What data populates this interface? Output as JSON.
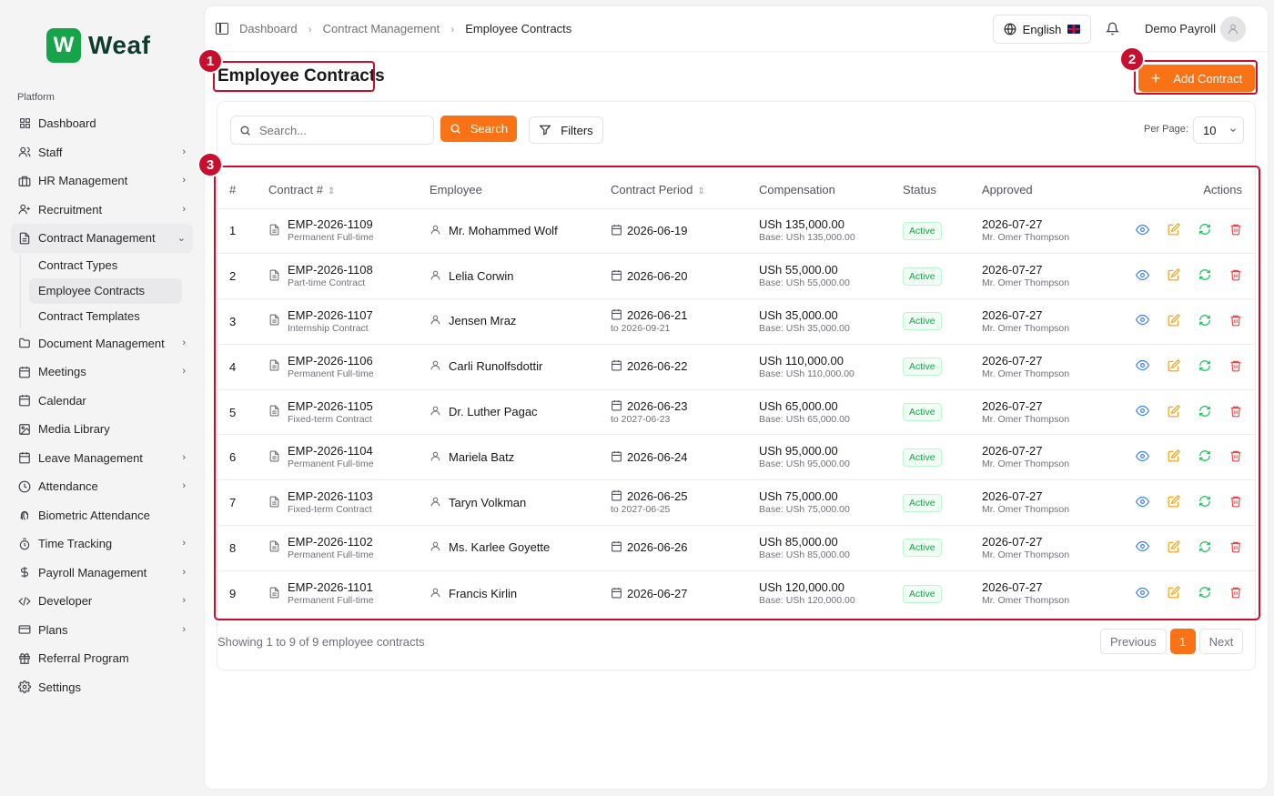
{
  "brand": {
    "mark": "W",
    "name": "Weaf"
  },
  "sidebar": {
    "section": "Platform",
    "items": [
      {
        "label": "Dashboard",
        "icon": "grid-icon",
        "chevron": false
      },
      {
        "label": "Staff",
        "icon": "users-icon",
        "chevron": true
      },
      {
        "label": "HR Management",
        "icon": "briefcase-icon",
        "chevron": true
      },
      {
        "label": "Recruitment",
        "icon": "user-plus-icon",
        "chevron": true
      },
      {
        "label": "Contract Management",
        "icon": "file-icon",
        "chevron": true,
        "open": true,
        "children": [
          "Contract Types",
          "Employee Contracts",
          "Contract Templates"
        ],
        "active_child": "Employee Contracts"
      },
      {
        "label": "Document Management",
        "icon": "folder-icon",
        "chevron": true
      },
      {
        "label": "Meetings",
        "icon": "calendar-icon",
        "chevron": true
      },
      {
        "label": "Calendar",
        "icon": "calendar-icon",
        "chevron": false
      },
      {
        "label": "Media Library",
        "icon": "image-icon",
        "chevron": false
      },
      {
        "label": "Leave Management",
        "icon": "calendar-icon",
        "chevron": true
      },
      {
        "label": "Attendance",
        "icon": "clock-icon",
        "chevron": true
      },
      {
        "label": "Biometric Attendance",
        "icon": "fingerprint-icon",
        "chevron": false
      },
      {
        "label": "Time Tracking",
        "icon": "timer-icon",
        "chevron": true
      },
      {
        "label": "Payroll Management",
        "icon": "dollar-icon",
        "chevron": true
      },
      {
        "label": "Developer",
        "icon": "code-icon",
        "chevron": true
      },
      {
        "label": "Plans",
        "icon": "card-icon",
        "chevron": true
      },
      {
        "label": "Referral Program",
        "icon": "gift-icon",
        "chevron": false
      },
      {
        "label": "Settings",
        "icon": "gear-icon",
        "chevron": false
      }
    ]
  },
  "header": {
    "breadcrumb": [
      "Dashboard",
      "Contract Management",
      "Employee Contracts"
    ],
    "language": "English",
    "user": "Demo Payroll"
  },
  "page": {
    "title": "Employee Contracts",
    "add_label": "Add Contract",
    "annotations": [
      "1",
      "2",
      "3"
    ]
  },
  "toolbar": {
    "search_placeholder": "Search...",
    "search_label": "Search",
    "filters_label": "Filters",
    "per_page_label": "Per Page:",
    "per_page_value": "10"
  },
  "table": {
    "columns": [
      "#",
      "Contract #",
      "Employee",
      "Contract Period",
      "Compensation",
      "Status",
      "Approved",
      "Actions"
    ],
    "rows": [
      {
        "n": "1",
        "id": "EMP-2026-1109",
        "type": "Permanent Full-time",
        "employee": "Mr. Mohammed Wolf",
        "start": "2026-06-19",
        "end": "",
        "comp": "USh 135,000.00",
        "base": "Base: USh 135,000.00",
        "status": "Active",
        "approved": "2026-07-27",
        "approver": "Mr. Omer Thompson"
      },
      {
        "n": "2",
        "id": "EMP-2026-1108",
        "type": "Part-time Contract",
        "employee": "Lelia Corwin",
        "start": "2026-06-20",
        "end": "",
        "comp": "USh 55,000.00",
        "base": "Base: USh 55,000.00",
        "status": "Active",
        "approved": "2026-07-27",
        "approver": "Mr. Omer Thompson"
      },
      {
        "n": "3",
        "id": "EMP-2026-1107",
        "type": "Internship Contract",
        "employee": "Jensen Mraz",
        "start": "2026-06-21",
        "end": "to 2026-09-21",
        "comp": "USh 35,000.00",
        "base": "Base: USh 35,000.00",
        "status": "Active",
        "approved": "2026-07-27",
        "approver": "Mr. Omer Thompson"
      },
      {
        "n": "4",
        "id": "EMP-2026-1106",
        "type": "Permanent Full-time",
        "employee": "Carli Runolfsdottir",
        "start": "2026-06-22",
        "end": "",
        "comp": "USh 110,000.00",
        "base": "Base: USh 110,000.00",
        "status": "Active",
        "approved": "2026-07-27",
        "approver": "Mr. Omer Thompson"
      },
      {
        "n": "5",
        "id": "EMP-2026-1105",
        "type": "Fixed-term Contract",
        "employee": "Dr. Luther Pagac",
        "start": "2026-06-23",
        "end": "to 2027-06-23",
        "comp": "USh 65,000.00",
        "base": "Base: USh 65,000.00",
        "status": "Active",
        "approved": "2026-07-27",
        "approver": "Mr. Omer Thompson"
      },
      {
        "n": "6",
        "id": "EMP-2026-1104",
        "type": "Permanent Full-time",
        "employee": "Mariela Batz",
        "start": "2026-06-24",
        "end": "",
        "comp": "USh 95,000.00",
        "base": "Base: USh 95,000.00",
        "status": "Active",
        "approved": "2026-07-27",
        "approver": "Mr. Omer Thompson"
      },
      {
        "n": "7",
        "id": "EMP-2026-1103",
        "type": "Fixed-term Contract",
        "employee": "Taryn Volkman",
        "start": "2026-06-25",
        "end": "to 2027-06-25",
        "comp": "USh 75,000.00",
        "base": "Base: USh 75,000.00",
        "status": "Active",
        "approved": "2026-07-27",
        "approver": "Mr. Omer Thompson"
      },
      {
        "n": "8",
        "id": "EMP-2026-1102",
        "type": "Permanent Full-time",
        "employee": "Ms. Karlee Goyette",
        "start": "2026-06-26",
        "end": "",
        "comp": "USh 85,000.00",
        "base": "Base: USh 85,000.00",
        "status": "Active",
        "approved": "2026-07-27",
        "approver": "Mr. Omer Thompson"
      },
      {
        "n": "9",
        "id": "EMP-2026-1101",
        "type": "Permanent Full-time",
        "employee": "Francis Kirlin",
        "start": "2026-06-27",
        "end": "",
        "comp": "USh 120,000.00",
        "base": "Base: USh 120,000.00",
        "status": "Active",
        "approved": "2026-07-27",
        "approver": "Mr. Omer Thompson"
      }
    ]
  },
  "footer": {
    "showing": "Showing 1 to 9 of 9 employee contracts",
    "previous": "Previous",
    "page": "1",
    "next": "Next"
  },
  "colors": {
    "accent": "#f97316",
    "brand": "#16a34a",
    "annotation": "#c8102e",
    "view": "#3b82f6",
    "edit": "#f59e0b",
    "renew": "#22c55e",
    "delete": "#ef4444"
  }
}
